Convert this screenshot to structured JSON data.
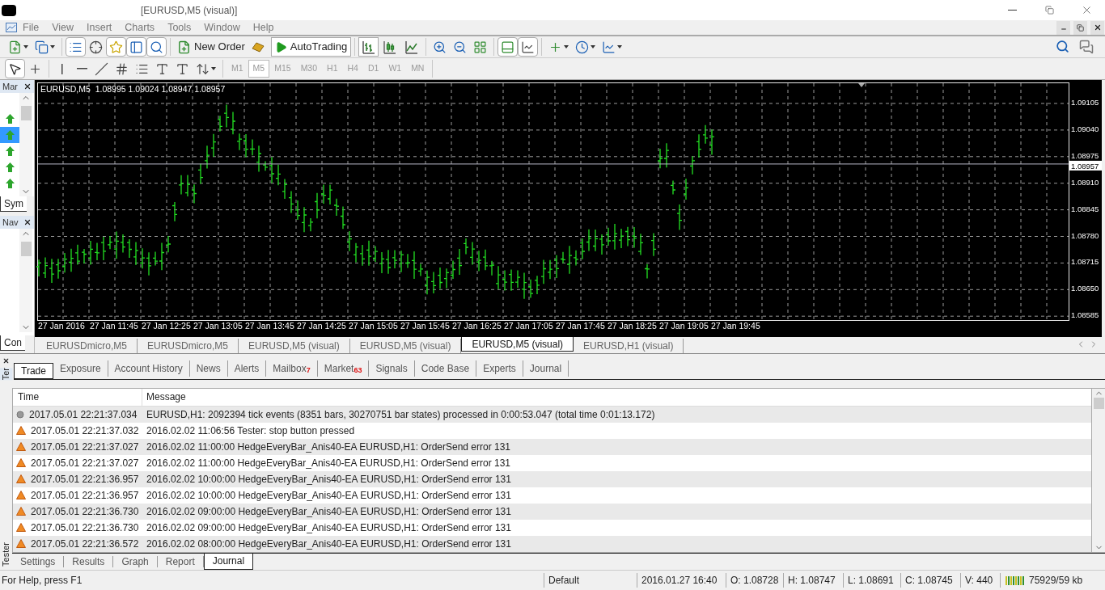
{
  "window": {
    "title": "[EURUSD,M5 (visual)]"
  },
  "menu": [
    "File",
    "View",
    "Insert",
    "Charts",
    "Tools",
    "Window",
    "Help"
  ],
  "toolbar": {
    "new_order": "New Order",
    "autotrading": {
      "label": "AutoTrading",
      "on": true
    }
  },
  "timeframes": [
    {
      "label": "M1",
      "selected": false
    },
    {
      "label": "M5",
      "selected": true
    },
    {
      "label": "M15",
      "selected": false
    },
    {
      "label": "M30",
      "selected": false
    },
    {
      "label": "H1",
      "selected": false
    },
    {
      "label": "H4",
      "selected": false
    },
    {
      "label": "D1",
      "selected": false
    },
    {
      "label": "W1",
      "selected": false
    },
    {
      "label": "MN",
      "selected": false
    }
  ],
  "market_watch": {
    "title": "Mar",
    "tab": "Sym",
    "rows": [
      {
        "selected": false
      },
      {
        "selected": true
      },
      {
        "selected": false
      },
      {
        "selected": false
      },
      {
        "selected": false
      }
    ]
  },
  "navigator": {
    "title": "Nav",
    "tab": "Con"
  },
  "chart": {
    "info": "EURUSD,M5  1.08995 1.09024 1.08947 1.08957",
    "price_labels": [
      "1.09105",
      "1.09040",
      "1.08975",
      "1.08910",
      "1.08845",
      "1.08780",
      "1.08715",
      "1.08650",
      "1.08585"
    ],
    "current_price": "1.08957",
    "time_labels": [
      "27 Jan 2016",
      "27 Jan 11:45",
      "27 Jan 12:25",
      "27 Jan 13:05",
      "27 Jan 13:45",
      "27 Jan 14:25",
      "27 Jan 15:05",
      "27 Jan 15:45",
      "27 Jan 16:25",
      "27 Jan 17:05",
      "27 Jan 17:45",
      "27 Jan 18:25",
      "27 Jan 19:05",
      "27 Jan 19:45"
    ]
  },
  "chart_tabs": [
    {
      "label": "EURUSDmicro,M5",
      "selected": false
    },
    {
      "label": "EURUSDmicro,M5",
      "selected": false
    },
    {
      "label": "EURUSD,M5 (visual)",
      "selected": false
    },
    {
      "label": "EURUSD,M5 (visual)",
      "selected": false
    },
    {
      "label": "EURUSD,M5 (visual)",
      "selected": true
    },
    {
      "label": "EURUSD,H1 (visual)",
      "selected": false
    }
  ],
  "terminal": {
    "side_label": "Ter",
    "tabs": [
      {
        "label": "Trade",
        "selected": true
      },
      {
        "label": "Exposure",
        "selected": false
      },
      {
        "label": "Account History",
        "selected": false
      },
      {
        "label": "News",
        "selected": false
      },
      {
        "label": "Alerts",
        "selected": false
      },
      {
        "label": "Mailbox",
        "badge": "7",
        "selected": false
      },
      {
        "label": "Market",
        "badge": "63",
        "selected": false
      },
      {
        "label": "Signals",
        "selected": false
      },
      {
        "label": "Code Base",
        "selected": false
      },
      {
        "label": "Experts",
        "selected": false
      },
      {
        "label": "Journal",
        "selected": false
      }
    ],
    "columns": [
      "Time",
      "Message"
    ],
    "rows": [
      {
        "kind": "info",
        "time": "2017.05.01 22:21:37.034",
        "message": "EURUSD,H1: 2092394 tick events (8351 bars, 30270751 bar states) processed in 0:00:53.047 (total time 0:01:13.172)"
      },
      {
        "kind": "warning",
        "time": "2017.05.01 22:21:37.032",
        "message": "2016.02.02 11:06:56  Tester: stop button pressed"
      },
      {
        "kind": "warning",
        "time": "2017.05.01 22:21:37.027",
        "message": "2016.02.02 11:00:00  HedgeEveryBar_Anis40-EA EURUSD,H1: OrderSend error 131"
      },
      {
        "kind": "warning",
        "time": "2017.05.01 22:21:37.027",
        "message": "2016.02.02 11:00:00  HedgeEveryBar_Anis40-EA EURUSD,H1: OrderSend error 131"
      },
      {
        "kind": "warning",
        "time": "2017.05.01 22:21:36.957",
        "message": "2016.02.02 10:00:00  HedgeEveryBar_Anis40-EA EURUSD,H1: OrderSend error 131"
      },
      {
        "kind": "warning",
        "time": "2017.05.01 22:21:36.957",
        "message": "2016.02.02 10:00:00  HedgeEveryBar_Anis40-EA EURUSD,H1: OrderSend error 131"
      },
      {
        "kind": "warning",
        "time": "2017.05.01 22:21:36.730",
        "message": "2016.02.02 09:00:00  HedgeEveryBar_Anis40-EA EURUSD,H1: OrderSend error 131"
      },
      {
        "kind": "warning",
        "time": "2017.05.01 22:21:36.730",
        "message": "2016.02.02 09:00:00  HedgeEveryBar_Anis40-EA EURUSD,H1: OrderSend error 131"
      },
      {
        "kind": "warning",
        "time": "2017.05.01 22:21:36.572",
        "message": "2016.02.02 08:00:00  HedgeEveryBar_Anis40-EA EURUSD,H1: OrderSend error 131"
      }
    ],
    "bottom_label": "Tester",
    "tester_tabs": [
      {
        "label": "Settings",
        "selected": false
      },
      {
        "label": "Results",
        "selected": false
      },
      {
        "label": "Graph",
        "selected": false
      },
      {
        "label": "Report",
        "selected": false
      },
      {
        "label": "Journal",
        "selected": true
      }
    ]
  },
  "status_bar": {
    "help": "For Help, press F1",
    "profile": "Default",
    "datetime": "2016.01.27 16:40",
    "open": "O: 1.08728",
    "high": "H: 1.08747",
    "low": "L: 1.08691",
    "close": "C: 1.08745",
    "volume": "V: 440",
    "traffic": "75929/59 kb"
  }
}
